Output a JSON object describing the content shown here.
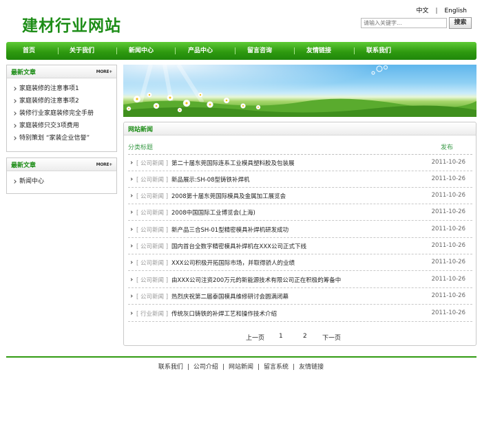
{
  "header": {
    "logo": "建材行业网站",
    "lang_cn": "中文",
    "lang_sep": "|",
    "lang_en": "English",
    "search_placeholder": "请输入关键字...",
    "search_button": "搜索"
  },
  "nav": {
    "items": [
      "首页",
      "关于我们",
      "新闻中心",
      "产品中心",
      "留言咨询",
      "友情链接",
      "联系我们"
    ]
  },
  "sidebar": {
    "box1": {
      "title": "最新文章",
      "more": "MORE+",
      "items": [
        "家庭装修的注意事项1",
        "家庭装修的注意事项2",
        "装修行业家庭装修完全手册",
        "家庭装修只交3项费用",
        "特别策划 “家装企业信誉”"
      ]
    },
    "box2": {
      "title": "最新文章",
      "more": "MORE+",
      "items": [
        "新闻中心"
      ]
    }
  },
  "news": {
    "title": "网站新闻",
    "col_title": "分类标题",
    "col_date": "发布",
    "rows": [
      {
        "cat": "[ 公司新闻 ]",
        "title": "第二十届东莞国际连系工业模具塑料胶及包装展",
        "date": "2011-10-26"
      },
      {
        "cat": "[ 公司新闻 ]",
        "title": "新品展示:SH-08型铸铁补焊机",
        "date": "2011-10-26"
      },
      {
        "cat": "[ 公司新闻 ]",
        "title": "2008第十届东莞国际模具及金属加工展览会",
        "date": "2011-10-26"
      },
      {
        "cat": "[ 公司新闻 ]",
        "title": "2008中国国际工业博览会(上海)",
        "date": "2011-10-26"
      },
      {
        "cat": "[ 公司新闻 ]",
        "title": "新产品三合SH-01型精密模具补焊机研发成功",
        "date": "2011-10-26"
      },
      {
        "cat": "[ 公司新闻 ]",
        "title": "国内首台全数字精密模具补焊机在XXX公司正式下线",
        "date": "2011-10-26"
      },
      {
        "cat": "[ 公司新闻 ]",
        "title": "XXX公司积极开拓国际市场，并取得骄人的业绩",
        "date": "2011-10-26"
      },
      {
        "cat": "[ 公司新闻 ]",
        "title": "由XXX公司注资200万元的新能源技术有限公司正在积极的筹备中",
        "date": "2011-10-26"
      },
      {
        "cat": "[ 公司新闻 ]",
        "title": "热烈庆祝第二届泰国模具维修研讨会圆满闭幕",
        "date": "2011-10-26"
      },
      {
        "cat": "[ 行业新闻 ]",
        "title": "传统灰口铸铁的补焊工艺和操作技术介绍",
        "date": "2011-10-26"
      }
    ],
    "pager": {
      "prev": "上一页",
      "page1": "1",
      "page2": "2",
      "next": "下一页"
    }
  },
  "footer": {
    "links": [
      "联系我们",
      "公司介绍",
      "网站新闻",
      "留言系统",
      "友情链接"
    ],
    "sep": "|"
  },
  "colors": {
    "brand_green": "#1d8d17",
    "nav_green": "#2f9a10"
  }
}
